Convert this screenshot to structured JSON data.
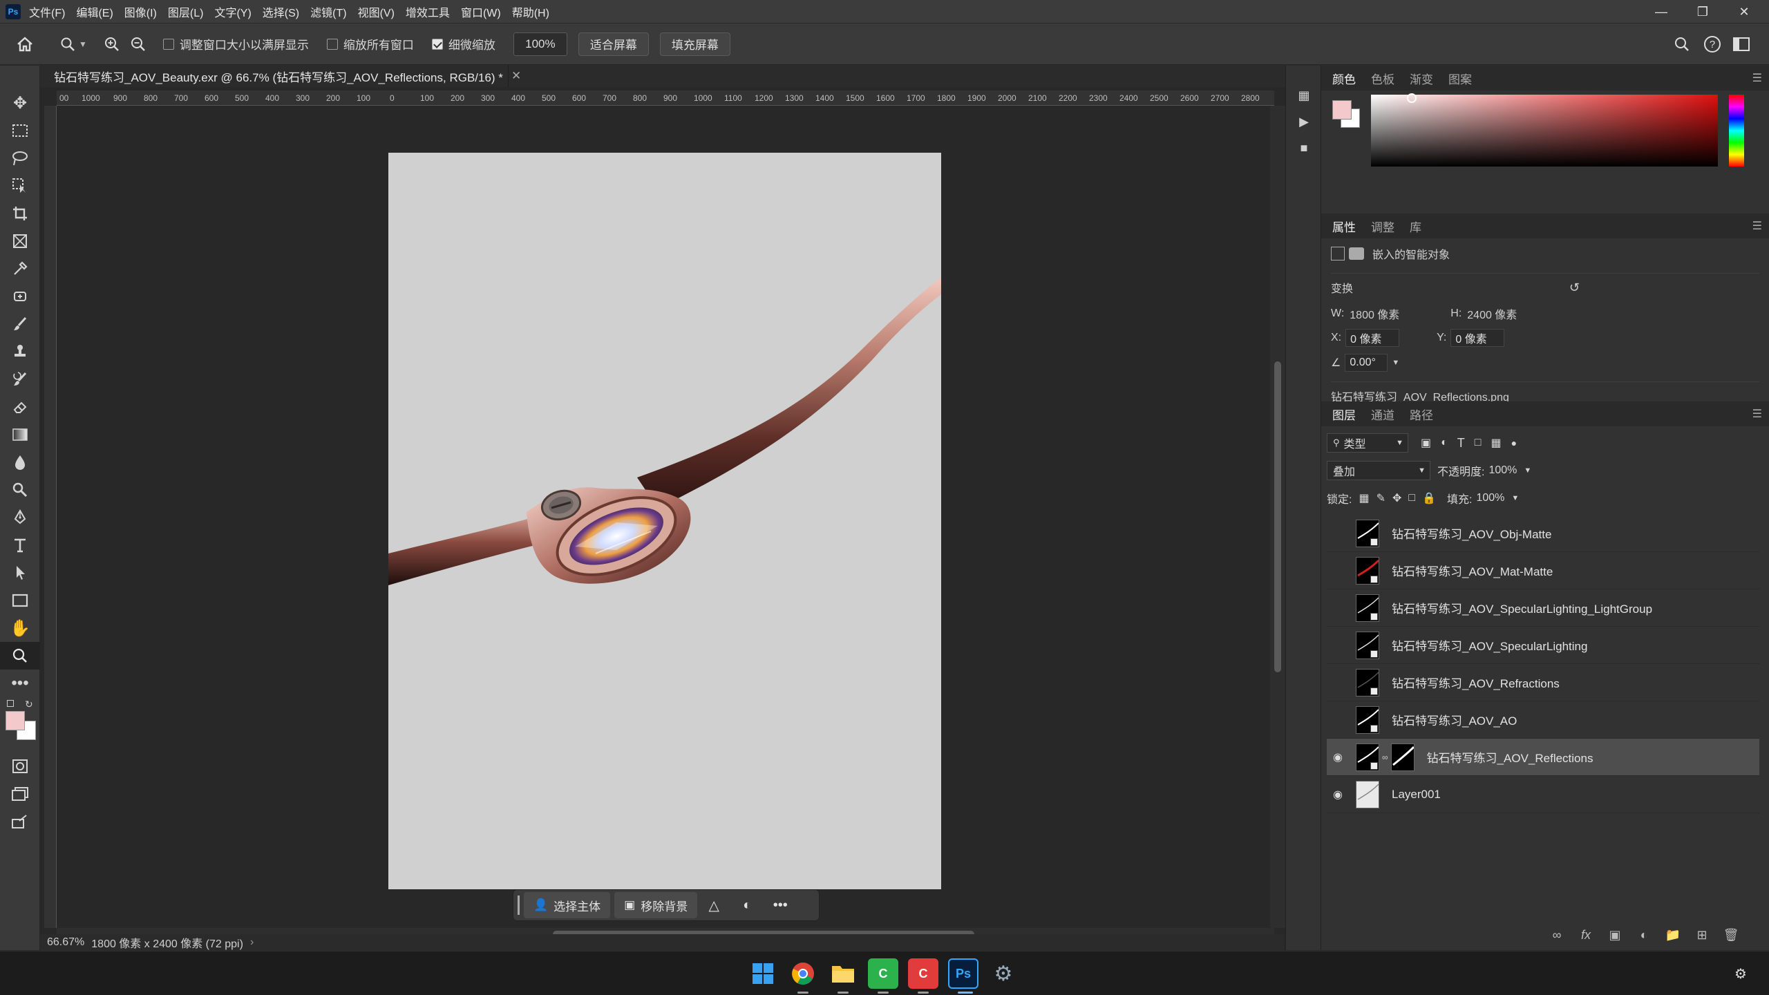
{
  "app": {
    "logo": "Ps",
    "menus": [
      "文件(F)",
      "编辑(E)",
      "图像(I)",
      "图层(L)",
      "文字(Y)",
      "选择(S)",
      "滤镜(T)",
      "视图(V)",
      "增效工具",
      "窗口(W)",
      "帮助(H)"
    ]
  },
  "options_bar": {
    "resize_windows_label": "调整窗口大小以满屏显示",
    "resize_windows_checked": false,
    "zoom_all_label": "缩放所有窗口",
    "zoom_all_checked": false,
    "scrubby_zoom_label": "细微缩放",
    "scrubby_zoom_checked": true,
    "zoom_value": "100%",
    "fit_screen_label": "适合屏幕",
    "fill_screen_label": "填充屏幕"
  },
  "document": {
    "tab_title": "钻石特写练习_AOV_Beauty.exr @ 66.7% (钻石特写练习_AOV_Reflections, RGB/16) *",
    "ruler_ticks": [
      "00",
      "1000",
      "900",
      "800",
      "700",
      "600",
      "500",
      "400",
      "300",
      "200",
      "100",
      "0",
      "100",
      "200",
      "300",
      "400",
      "500",
      "600",
      "700",
      "800",
      "900",
      "1000",
      "1100",
      "1200",
      "1300",
      "1400",
      "1500",
      "1600",
      "1700",
      "1800",
      "1900",
      "2000",
      "2100",
      "2200",
      "2300",
      "2400",
      "2500",
      "2600",
      "2700",
      "2800"
    ],
    "canvas_bg": "#d0d0d0"
  },
  "context_bar": {
    "select_subject_label": "选择主体",
    "remove_bg_label": "移除背景"
  },
  "status": {
    "zoom": "66.67%",
    "doc_info": "1800 像素 x 2400 像素 (72 ppi)"
  },
  "color_panel": {
    "tabs": [
      "颜色",
      "色板",
      "渐变",
      "图案"
    ],
    "fg_color": "#f4c9cc",
    "bg_color": "#ffffff"
  },
  "properties_panel": {
    "tabs": [
      "属性",
      "调整",
      "库"
    ],
    "object_type": "嵌入的智能对象",
    "transform_label": "变换",
    "w_label": "W:",
    "w_value": "1800 像素",
    "h_label": "H:",
    "h_value": "2400 像素",
    "x_label": "X:",
    "x_value": "0 像素",
    "y_label": "Y:",
    "y_value": "0 像素",
    "angle_value": "0.00°",
    "linked_file": "钻石特写练习_AOV_Reflections.png"
  },
  "layers_panel": {
    "tabs": [
      "图层",
      "通道",
      "路径"
    ],
    "filter_kind": "类型",
    "blend_mode": "叠加",
    "opacity_label": "不透明度:",
    "opacity_value": "100%",
    "lock_label": "锁定:",
    "fill_label": "填充:",
    "fill_value": "100%",
    "layers": [
      {
        "name": "钻石特写练习_AOV_Obj-Matte",
        "visible": false,
        "selected": false
      },
      {
        "name": "钻石特写练习_AOV_Mat-Matte",
        "visible": false,
        "selected": false
      },
      {
        "name": "钻石特写练习_AOV_SpecularLighting_LightGroup",
        "visible": false,
        "selected": false
      },
      {
        "name": "钻石特写练习_AOV_SpecularLighting",
        "visible": false,
        "selected": false
      },
      {
        "name": "钻石特写练习_AOV_Refractions",
        "visible": false,
        "selected": false
      },
      {
        "name": "钻石特写练习_AOV_AO",
        "visible": false,
        "selected": false
      },
      {
        "name": "钻石特写练习_AOV_Reflections",
        "visible": true,
        "selected": true
      },
      {
        "name": "Layer001",
        "visible": true,
        "selected": false
      }
    ]
  }
}
